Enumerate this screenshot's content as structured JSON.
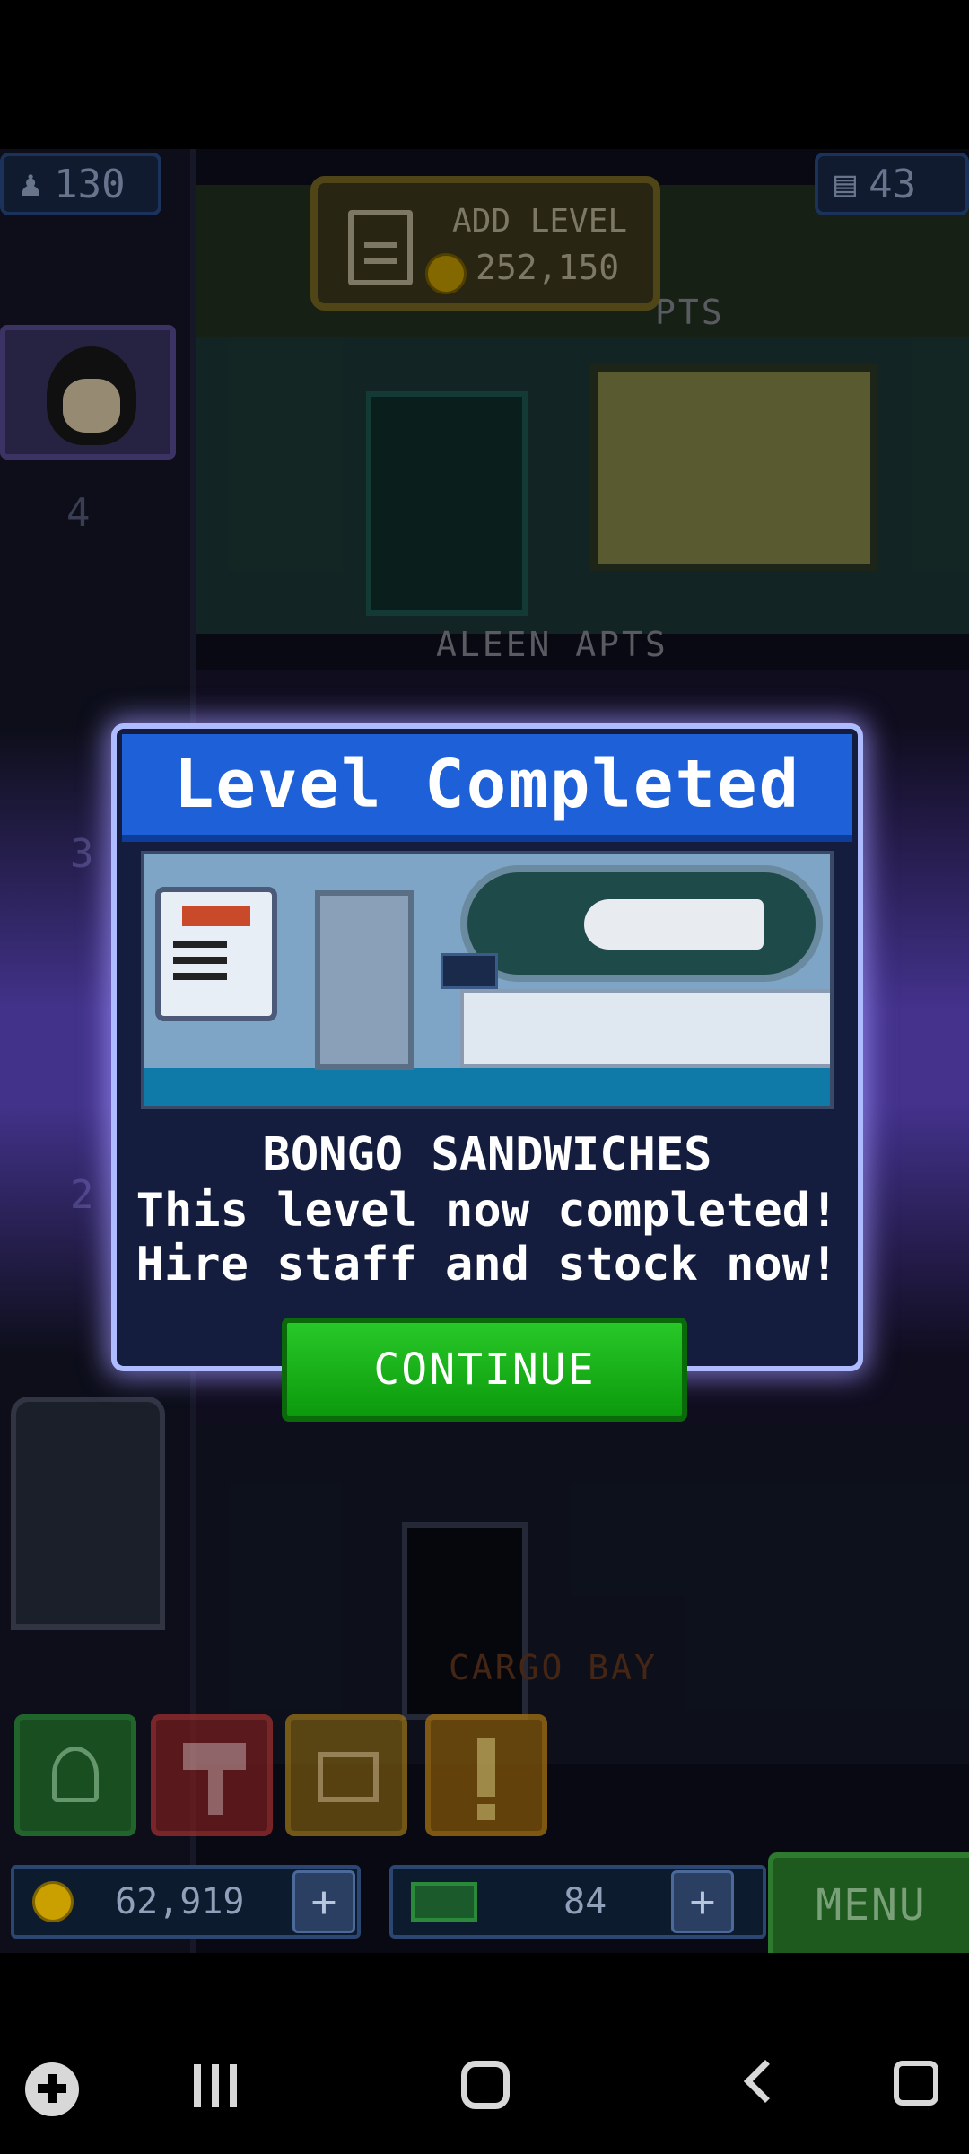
{
  "hud": {
    "population": "130",
    "floors": "43",
    "add_level_label": "ADD LEVEL",
    "add_level_cost": "252,150",
    "coins": "62,919",
    "bux": "84",
    "menu_label": "MENU"
  },
  "floors": {
    "top_label": "PTS",
    "aleen_label": "ALEEN APTS",
    "cargo_label": "CARGO BAY",
    "shaft_numbers": [
      "4",
      "3",
      "2"
    ]
  },
  "dialog": {
    "title": "Level Completed",
    "level_name": "BONGO SANDWICHES",
    "line1": "This level now completed!",
    "line2": "Hire staff and stock now!",
    "continue_label": "CONTINUE"
  },
  "colors": {
    "title_bar": "#1d60d8",
    "continue_button": "#16b016",
    "dialog_border": "#aebcff"
  },
  "icons": [
    "person-icon",
    "elevator-icon",
    "coin-icon",
    "add-level-icon",
    "game-launcher-icon",
    "recents-icon",
    "home-icon",
    "back-icon",
    "screenshot-icon"
  ]
}
